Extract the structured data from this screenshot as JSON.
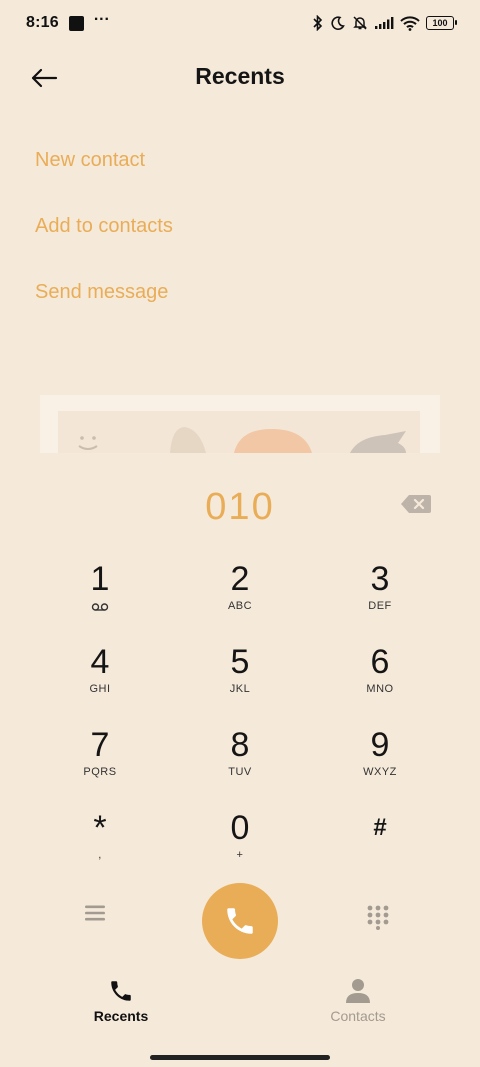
{
  "status_bar": {
    "time": "8:16",
    "dots": "···",
    "battery": "100"
  },
  "header": {
    "title": "Recents"
  },
  "actions": [
    {
      "label": "New contact"
    },
    {
      "label": "Add to contacts"
    },
    {
      "label": "Send message"
    }
  ],
  "dialer": {
    "number": "010"
  },
  "keypad": [
    {
      "digit": "1",
      "letters": ""
    },
    {
      "digit": "2",
      "letters": "ABC"
    },
    {
      "digit": "3",
      "letters": "DEF"
    },
    {
      "digit": "4",
      "letters": "GHI"
    },
    {
      "digit": "5",
      "letters": "JKL"
    },
    {
      "digit": "6",
      "letters": "MNO"
    },
    {
      "digit": "7",
      "letters": "PQRS"
    },
    {
      "digit": "8",
      "letters": "TUV"
    },
    {
      "digit": "9",
      "letters": "WXYZ"
    },
    {
      "digit": "*",
      "letters": ","
    },
    {
      "digit": "0",
      "letters": "+"
    },
    {
      "digit": "#",
      "letters": ""
    }
  ],
  "tabs": [
    {
      "label": "Recents",
      "icon": "phone-icon"
    },
    {
      "label": "Contacts",
      "icon": "person-icon"
    }
  ],
  "colors": {
    "accent": "#e9ad57",
    "background": "#f5e9da"
  }
}
